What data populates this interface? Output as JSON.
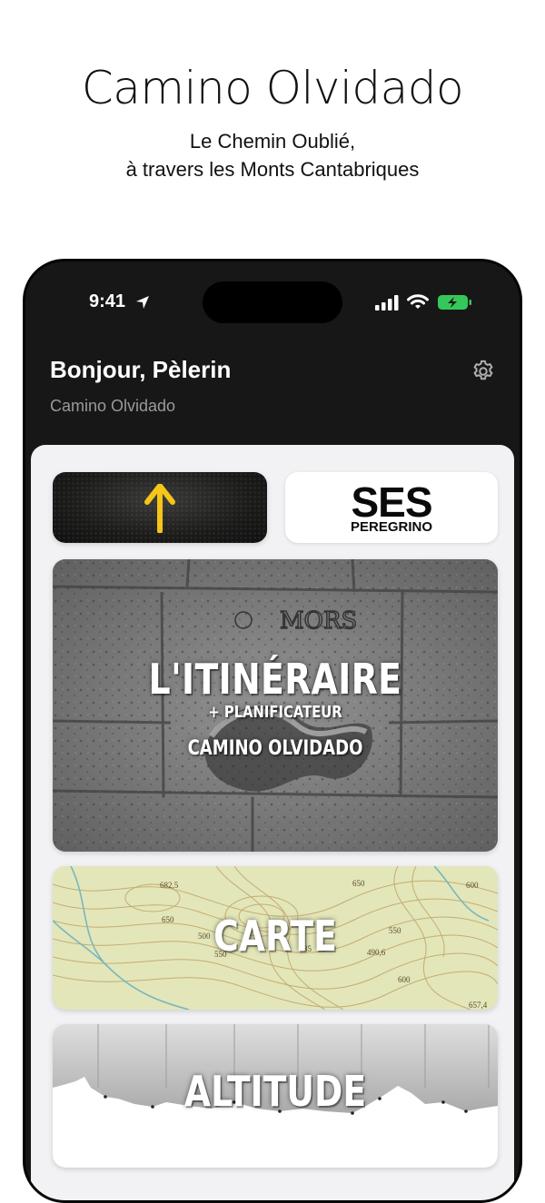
{
  "promo": {
    "title": "Camino Olvidado",
    "subtitle_line1": "Le Chemin Oublié,",
    "subtitle_line2": "à travers les Monts Cantabriques"
  },
  "status_bar": {
    "time": "9:41",
    "icons": [
      "location-arrow-icon",
      "cellular-signal-icon",
      "wifi-icon",
      "battery-charging-icon"
    ],
    "battery_color": "#34c759"
  },
  "header": {
    "greeting": "Bonjour, Pèlerin",
    "subtitle": "Camino Olvidado",
    "settings_icon": "gear-icon"
  },
  "tiles": {
    "arrow_tile": {
      "icon": "yellow-arrow-up-icon",
      "accent": "#f5c518"
    },
    "ses_tile": {
      "logo_big": "SES",
      "logo_small": "PEREGRINO"
    },
    "itinerary": {
      "title": "L'ITINÉRAIRE",
      "subtitle": "+ PLANIFICATEUR",
      "caption": "CAMINO OLVIDADO",
      "background_inscription": "MORS"
    },
    "map": {
      "title": "CARTE",
      "elevation_labels": [
        "682,5",
        "650",
        "600",
        "550",
        "490,6",
        "600",
        "650",
        "550",
        "500",
        "35",
        "657,4"
      ]
    },
    "altitude": {
      "title": "ALTITUDE"
    }
  },
  "colors": {
    "sheet_bg": "#f2f2f4",
    "phone_bg": "#171717"
  }
}
